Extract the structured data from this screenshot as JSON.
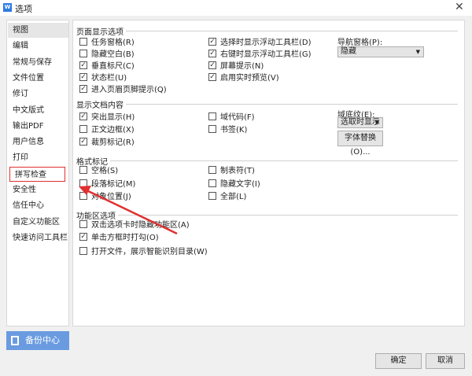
{
  "window": {
    "title": "选项",
    "close": "✕"
  },
  "sidebar": {
    "items": [
      "视图",
      "编辑",
      "常规与保存",
      "文件位置",
      "修订",
      "中文版式",
      "输出PDF",
      "用户信息",
      "打印",
      "拼写检查",
      "安全性",
      "信任中心",
      "自定义功能区",
      "快速访问工具栏"
    ],
    "backup": "备份中心"
  },
  "sections": {
    "page": {
      "title": "页面显示选项",
      "left": [
        {
          "label": "任务窗格(R)",
          "checked": false
        },
        {
          "label": "隐藏空白(B)",
          "checked": false
        },
        {
          "label": "垂直标尺(C)",
          "checked": true
        },
        {
          "label": "状态栏(U)",
          "checked": true
        },
        {
          "label": "进入页眉页脚提示(Q)",
          "checked": true
        }
      ],
      "right": [
        {
          "label": "选择时显示浮动工具栏(D)",
          "checked": true
        },
        {
          "label": "右键时显示浮动工具栏(G)",
          "checked": true
        },
        {
          "label": "屏幕提示(N)",
          "checked": true
        },
        {
          "label": "启用实时预览(V)",
          "checked": true
        }
      ],
      "nav_label": "导航窗格(P):",
      "nav_value": "隐藏"
    },
    "doc": {
      "title": "显示文档内容",
      "left": [
        {
          "label": "突出显示(H)",
          "checked": true
        },
        {
          "label": "正文边框(X)",
          "checked": false
        },
        {
          "label": "裁剪标记(R)",
          "checked": true
        }
      ],
      "right": [
        {
          "label": "域代码(F)",
          "checked": false
        },
        {
          "label": "书签(K)",
          "checked": false
        }
      ],
      "shade_label": "域底纹(E):",
      "shade_value": "选取时显示",
      "font_btn": "字体替换(O)..."
    },
    "fmt": {
      "title": "格式标记",
      "left": [
        {
          "label": "空格(S)",
          "checked": false
        },
        {
          "label": "段落标记(M)",
          "checked": false
        },
        {
          "label": "对象位置(J)",
          "checked": false
        }
      ],
      "right": [
        {
          "label": "制表符(T)",
          "checked": false
        },
        {
          "label": "隐藏文字(I)",
          "checked": false
        },
        {
          "label": "全部(L)",
          "checked": false
        }
      ]
    },
    "ribbon": {
      "title": "功能区选项",
      "left": [
        {
          "label": "双击选项卡时隐藏功能区(A)",
          "checked": false
        },
        {
          "label": "单击方框时打勾(O)",
          "checked": true
        },
        {
          "label": "打开文件，展示智能识别目录(W)",
          "checked": false
        }
      ]
    }
  },
  "footer": {
    "ok": "确定",
    "cancel": "取消"
  }
}
